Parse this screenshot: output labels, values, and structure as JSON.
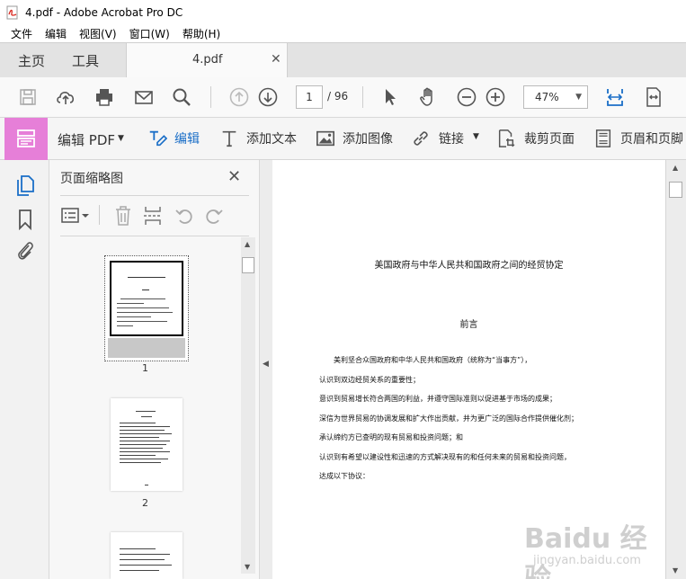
{
  "window": {
    "title": "4.pdf - Adobe Acrobat Pro DC"
  },
  "menu": {
    "items": [
      "文件",
      "编辑",
      "视图(V)",
      "窗口(W)",
      "帮助(H)"
    ]
  },
  "tabs": {
    "home": "主页",
    "tools": "工具",
    "document": "4.pdf"
  },
  "toolbar": {
    "current_page": "1",
    "total_pages": "/ 96",
    "zoom": "47%"
  },
  "editbar": {
    "mode_label": "编辑 PDF",
    "edit": "编辑",
    "add_text": "添加文本",
    "add_image": "添加图像",
    "link": "链接",
    "crop": "裁剪页面",
    "header_footer": "页眉和页脚"
  },
  "thumbnails": {
    "title": "页面缩略图",
    "pages": [
      "1",
      "2"
    ]
  },
  "document": {
    "title": "美国政府与中华人民共和国政府之间的经贸协定",
    "section": "前言",
    "lines": [
      "　　美利坚合众国政府和中华人民共和国政府（统称为“当事方”），",
      "认识到双边经贸关系的重要性；",
      "意识到贸易增长符合两国的利益，并遵守国际准则以促进基于市场的成果；",
      "深信为世界贸易的协调发展和扩大作出贡献，并为更广泛的国际合作提供催化剂；",
      "承认缔约方已查明的现有贸易和投资问题；和",
      "认识到有希望以建设性和迅速的方式解决现有的和任何未来的贸易和投资问题，",
      "达成以下协议："
    ]
  },
  "watermark": {
    "brand": "Baidu 经验",
    "url": "jingyan.baidu.com"
  },
  "colors": {
    "edit_badge": "#e67fd8",
    "accent_blue": "#1a6ec7",
    "pdf_red": "#d9251c"
  }
}
